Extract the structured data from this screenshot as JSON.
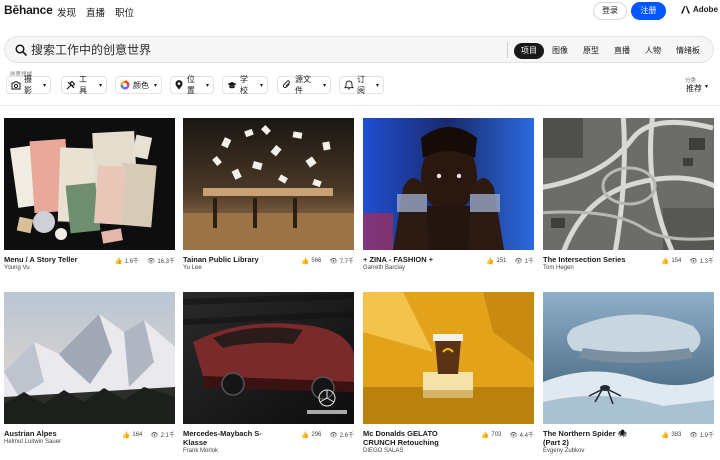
{
  "nav": {
    "logo": "Bēhance",
    "items": [
      "发现",
      "直播",
      "职位"
    ],
    "login": "登录",
    "signup": "注册",
    "adobe": "Adobe"
  },
  "search": {
    "placeholder": "搜索工作中的创意世界",
    "tabs": [
      {
        "label": "项目",
        "active": true
      },
      {
        "label": "图像",
        "active": false
      },
      {
        "label": "原型",
        "active": false
      },
      {
        "label": "直播",
        "active": false
      },
      {
        "label": "人物",
        "active": false
      },
      {
        "label": "情绪板",
        "active": false
      }
    ]
  },
  "filters": {
    "caption": "创意领域",
    "items": [
      {
        "label": "摄影",
        "icon": "camera-icon"
      },
      {
        "label": "工具",
        "icon": "tools-icon"
      },
      {
        "label": "颜色",
        "icon": "color-wheel-icon"
      },
      {
        "label": "位置",
        "icon": "location-pin-icon"
      },
      {
        "label": "学校",
        "icon": "graduation-cap-icon"
      },
      {
        "label": "源文件",
        "icon": "paperclip-icon"
      },
      {
        "label": "订阅",
        "icon": "subscription-icon"
      }
    ],
    "sort_caption": "分类",
    "sort_value": "推荐"
  },
  "projects": [
    {
      "title": "Menu / A Story Teller",
      "owner": "Young Vu",
      "likes": "1.6千",
      "views": "16.3千"
    },
    {
      "title": "Tainan Public Library",
      "owner": "Yu Lee",
      "likes": "566",
      "views": "7.7千"
    },
    {
      "title": "+ ZINA - FASHION +",
      "owner": "Garreth Barclay",
      "likes": "151",
      "views": "1千"
    },
    {
      "title": "The Intersection Series",
      "owner": "Tom Hegen",
      "likes": "154",
      "views": "1.3千"
    },
    {
      "title": "Austrian Alpes",
      "owner": "Helmut Luitwin Sauer",
      "likes": "164",
      "views": "2.1千"
    },
    {
      "title": "Mercedes-Maybach S-Klasse",
      "owner": "Frank Morlok",
      "likes": "296",
      "views": "2.6千"
    },
    {
      "title": "Mc Donalds GELATO CRUNCH Retouching",
      "owner": "DIEGO SALAS",
      "likes": "703",
      "views": "4.4千"
    },
    {
      "title": "The Northern Spider 🕷 (Part 2)",
      "owner": "Evgeny Zubkov",
      "likes": "383",
      "views": "1.9千"
    }
  ],
  "colors": {
    "accent": "#0057ff",
    "active_tab": "#191919"
  }
}
